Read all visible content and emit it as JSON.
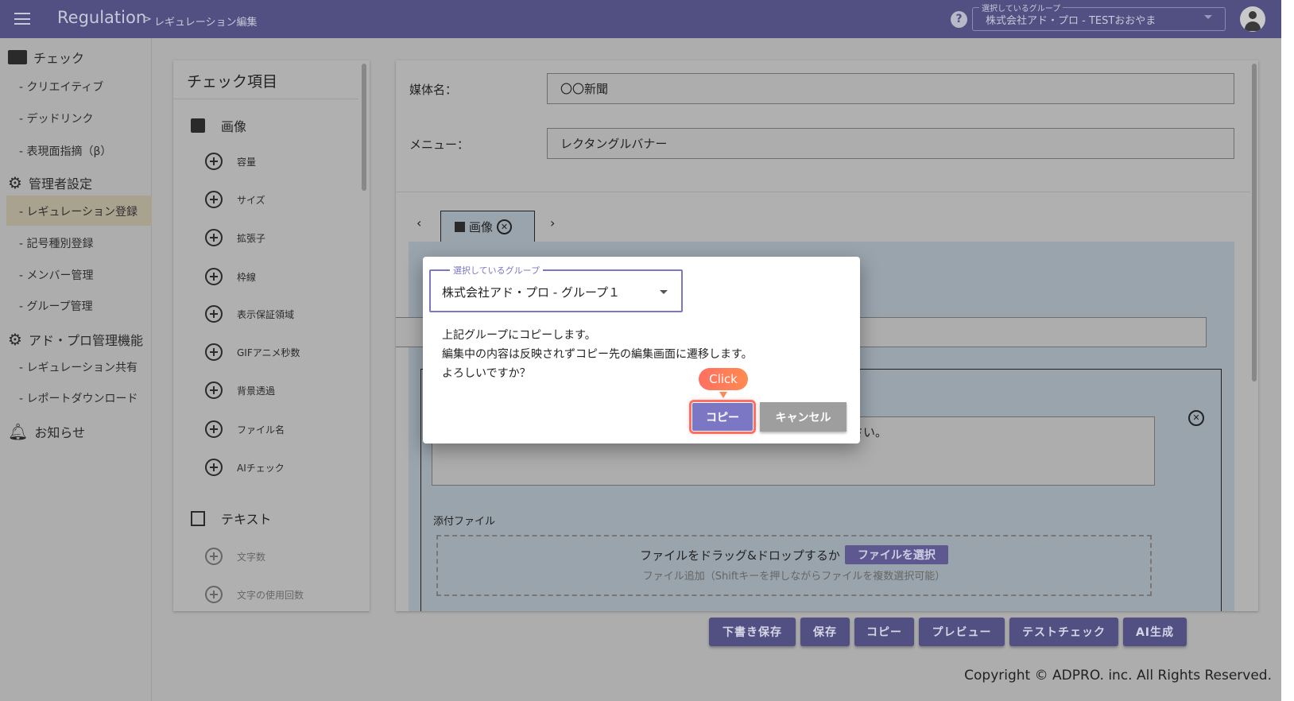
{
  "header": {
    "app_title": "Regulation",
    "breadcrumb_sep": ">",
    "breadcrumb_page": "レギュレーション編集",
    "group_label": "選択しているグループ",
    "group_value": "株式会社アド・プロ - TESTおおやま"
  },
  "sidebar": {
    "check": "チェック",
    "creative": "- クリエイティブ",
    "deadlink": "- デッドリンク",
    "expression": "- 表現面指摘（β）",
    "admin": "管理者設定",
    "reg_register": "- レギュレーション登録",
    "symbol": "- 記号種別登録",
    "member": "- メンバー管理",
    "group": "- グループ管理",
    "adpro": "アド・プロ管理機能",
    "reg_share": "- レギュレーション共有",
    "report": "- レポートダウンロード",
    "news": "お知らせ"
  },
  "check_items": {
    "title": "チェック項目",
    "image_section": "画像",
    "image_items": [
      "容量",
      "サイズ",
      "拡張子",
      "枠線",
      "表示保証領域",
      "GIFアニメ秒数",
      "背景透過",
      "ファイル名",
      "AIチェック"
    ],
    "text_section": "テキスト",
    "text_items": [
      "文字数",
      "文字の使用回数"
    ]
  },
  "form": {
    "media_label": "媒体名：",
    "media_value": "〇〇新聞",
    "menu_label": "メニュー：",
    "menu_value": "レクタングルバナー",
    "tab_label": "画像",
    "textarea_fragment": "さい。",
    "attach_label": "添付ファイル",
    "drop_text": "ファイルをドラッグ&ドロップするか",
    "select_file": "ファイルを選択",
    "drop_hint": "ファイル追加（Shiftキーを押しながらファイルを複数選択可能）"
  },
  "dialog": {
    "select_label": "選択しているグループ",
    "select_value": "株式会社アド・プロ - グループ１",
    "line1": "上記グループにコピーします。",
    "line2": "編集中の内容は反映されずコピー先の編集画面に遷移します。",
    "line3": "よろしいですか？",
    "copy": "コピー",
    "cancel": "キャンセル",
    "click_hint": "Click"
  },
  "actions": [
    "下書き保存",
    "保存",
    "コピー",
    "プレビュー",
    "テストチェック",
    "AI生成"
  ],
  "footer": "Copyright © ADPRO. inc. All Rights Reserved.",
  "colors": {
    "primary": "#7b77c4",
    "header": "#524f82",
    "highlight": "#ff6f61"
  }
}
